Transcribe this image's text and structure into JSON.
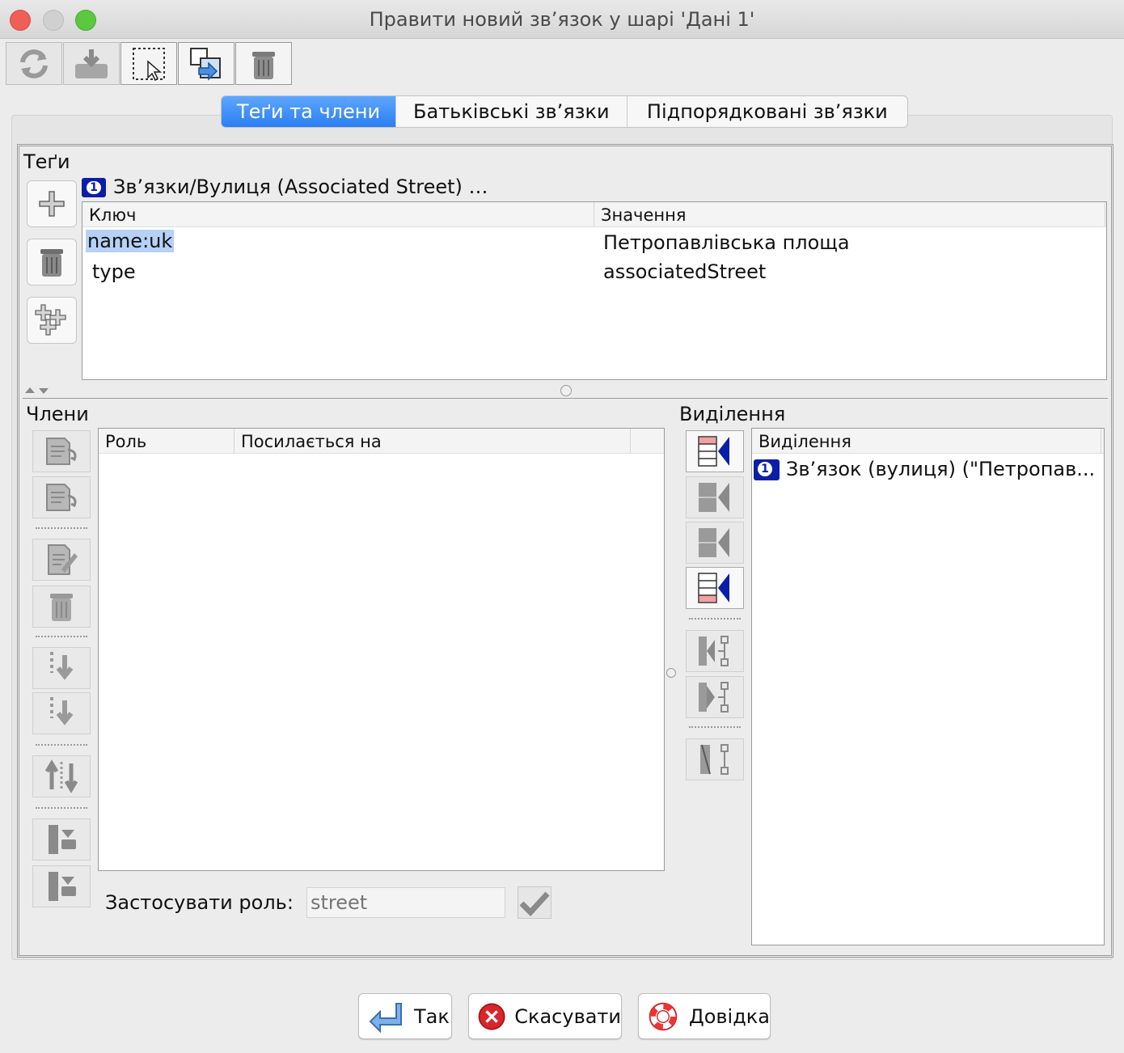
{
  "window": {
    "title": "Правити новий зв’язок у шарі 'Дані 1'"
  },
  "toolbar": {
    "buttons": [
      {
        "icon": "refresh-icon"
      },
      {
        "icon": "download-icon"
      },
      {
        "icon": "select-area-icon"
      },
      {
        "icon": "zoom-to-icon"
      },
      {
        "icon": "trash-icon"
      }
    ]
  },
  "tabs": [
    {
      "label": "Теґи та члени",
      "active": true
    },
    {
      "label": "Батьківські зв’язки",
      "active": false
    },
    {
      "label": "Підпорядковані зв’язки",
      "active": false
    }
  ],
  "tags": {
    "section_label": "Теґи",
    "relation_badge": "1",
    "relation_label": "Зв’язки/Вулиця (Associated Street) …",
    "columns": [
      "Ключ",
      "Значення"
    ],
    "rows": [
      {
        "key": "name:uk",
        "value": "Петропавлівська площа",
        "selected": true
      },
      {
        "key": "type",
        "value": "associatedStreet",
        "selected": false
      }
    ]
  },
  "members": {
    "section_label": "Члени",
    "columns": [
      "Роль",
      "Посилається на"
    ],
    "rows": [],
    "apply_role_label": "Застосувати роль:",
    "role_placeholder": "street"
  },
  "selection": {
    "section_label": "Виділення",
    "column": "Виділення",
    "rows": [
      {
        "badge": "1",
        "label": "Зв’язок (вулиця) (\"Петропав..."
      }
    ]
  },
  "buttons": {
    "ok": "Так",
    "cancel": "Скасувати",
    "help": "Довідка"
  },
  "colors": {
    "accent_blue": "#2a7ff2",
    "selection_highlight": "#b6d1f5",
    "relation_icon_blue": "#0b1ea6",
    "cancel_red": "#d8262b"
  }
}
